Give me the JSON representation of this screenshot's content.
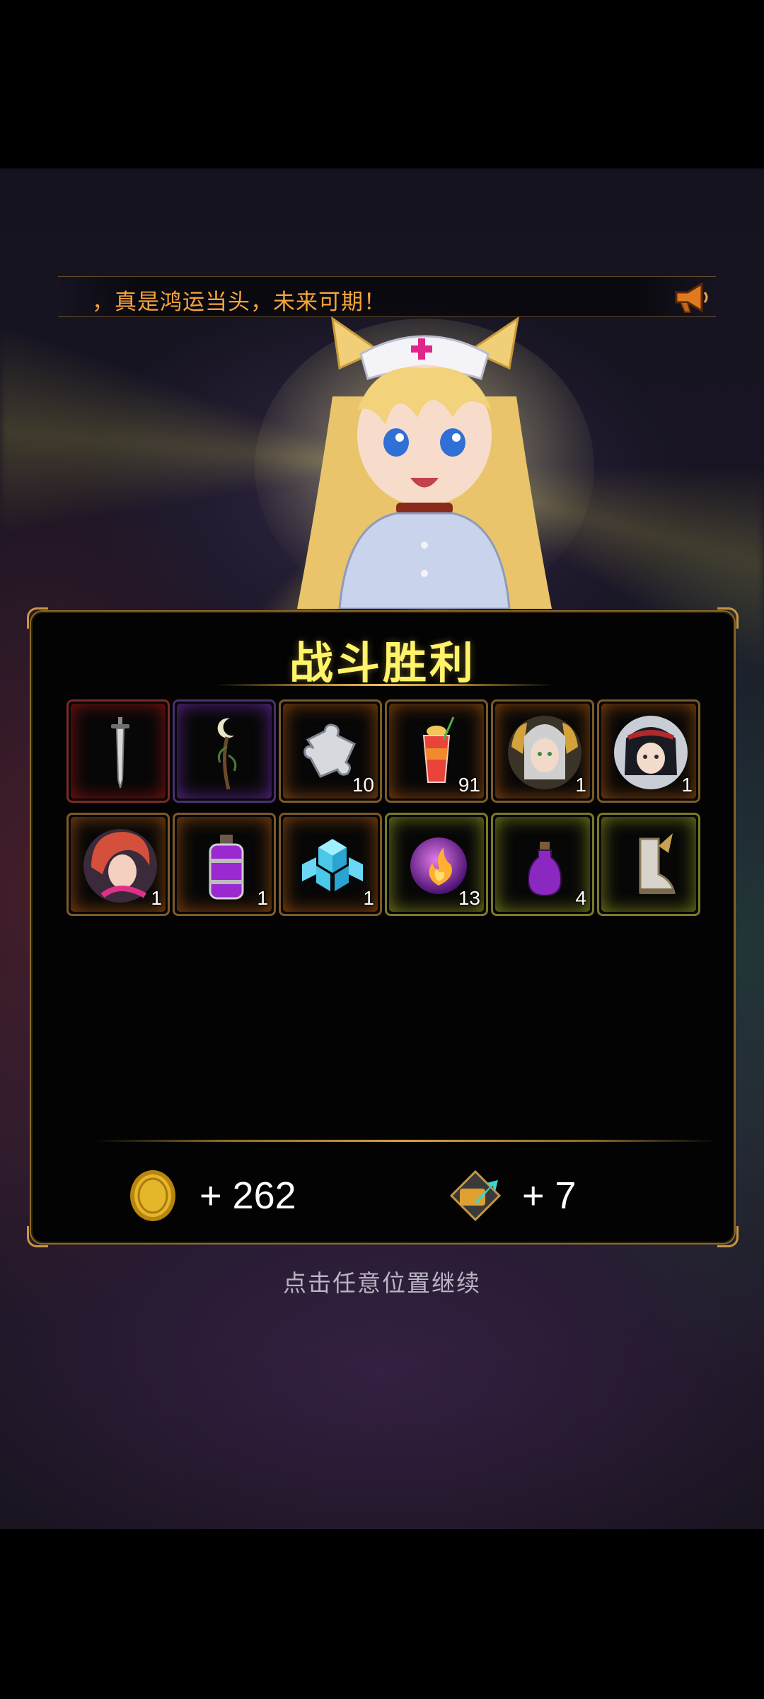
{
  "announcement": {
    "text": "，真是鸿运当头，未来可期！",
    "icon": "megaphone-icon"
  },
  "result": {
    "title": "战斗胜利"
  },
  "items": [
    {
      "name": "dagger",
      "count": "",
      "rarity": "red"
    },
    {
      "name": "moon-staff",
      "count": "",
      "rarity": "purple"
    },
    {
      "name": "puzzle-piece",
      "count": "10",
      "rarity": "orange"
    },
    {
      "name": "cocktail-drink",
      "count": "91",
      "rarity": "orange"
    },
    {
      "name": "silver-haired-hero-portrait",
      "count": "1",
      "rarity": "orange"
    },
    {
      "name": "dark-haired-hero-portrait",
      "count": "1",
      "rarity": "orange"
    },
    {
      "name": "red-haired-hero-portrait",
      "count": "1",
      "rarity": "orange"
    },
    {
      "name": "purple-potion-large",
      "count": "1",
      "rarity": "orange"
    },
    {
      "name": "ice-cubes",
      "count": "1",
      "rarity": "orange"
    },
    {
      "name": "fire-orb",
      "count": "13",
      "rarity": "yellow"
    },
    {
      "name": "purple-potion-small",
      "count": "4",
      "rarity": "yellow"
    },
    {
      "name": "winged-boots",
      "count": "",
      "rarity": "yellow"
    }
  ],
  "rewards": {
    "gold": {
      "icon": "gold-coin-icon",
      "value": "+ 262"
    },
    "exp": {
      "icon": "exp-arrow-icon",
      "value": "+ 7"
    }
  },
  "hint": "点击任意位置继续"
}
